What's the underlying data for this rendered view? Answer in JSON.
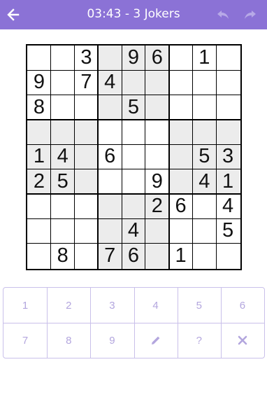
{
  "header": {
    "title": "03:43 - 3 Jokers",
    "back_icon": "arrow-left-icon",
    "undo_icon": "undo-icon",
    "redo_icon": "redo-icon",
    "bar_color": "#8b72d6"
  },
  "grid": [
    [
      "",
      "",
      "3",
      "",
      "9",
      "6",
      "",
      "1",
      ""
    ],
    [
      "9",
      "",
      "7",
      "4",
      "",
      "",
      "",
      "",
      ""
    ],
    [
      "8",
      "",
      "",
      "",
      "5",
      "",
      "",
      "",
      ""
    ],
    [
      "",
      "",
      "",
      "",
      "",
      "",
      "",
      "",
      ""
    ],
    [
      "1",
      "4",
      "",
      "6",
      "",
      "",
      "",
      "5",
      "3"
    ],
    [
      "2",
      "5",
      "",
      "",
      "",
      "9",
      "",
      "4",
      "1"
    ],
    [
      "",
      "",
      "",
      "",
      "",
      "2",
      "6",
      "",
      "4"
    ],
    [
      "",
      "",
      "",
      "",
      "4",
      "",
      "",
      "",
      "5"
    ],
    [
      "",
      "8",
      "",
      "7",
      "6",
      "",
      "1",
      "",
      ""
    ]
  ],
  "highlight_color": "#ececec",
  "keypad": {
    "row1": [
      "1",
      "2",
      "3",
      "4",
      "5",
      "6"
    ],
    "row2": [
      "7",
      "8",
      "9"
    ],
    "pencil_icon": "pencil-icon",
    "hint_label": "?",
    "clear_icon": "close-icon",
    "key_color": "#b3a6de"
  }
}
